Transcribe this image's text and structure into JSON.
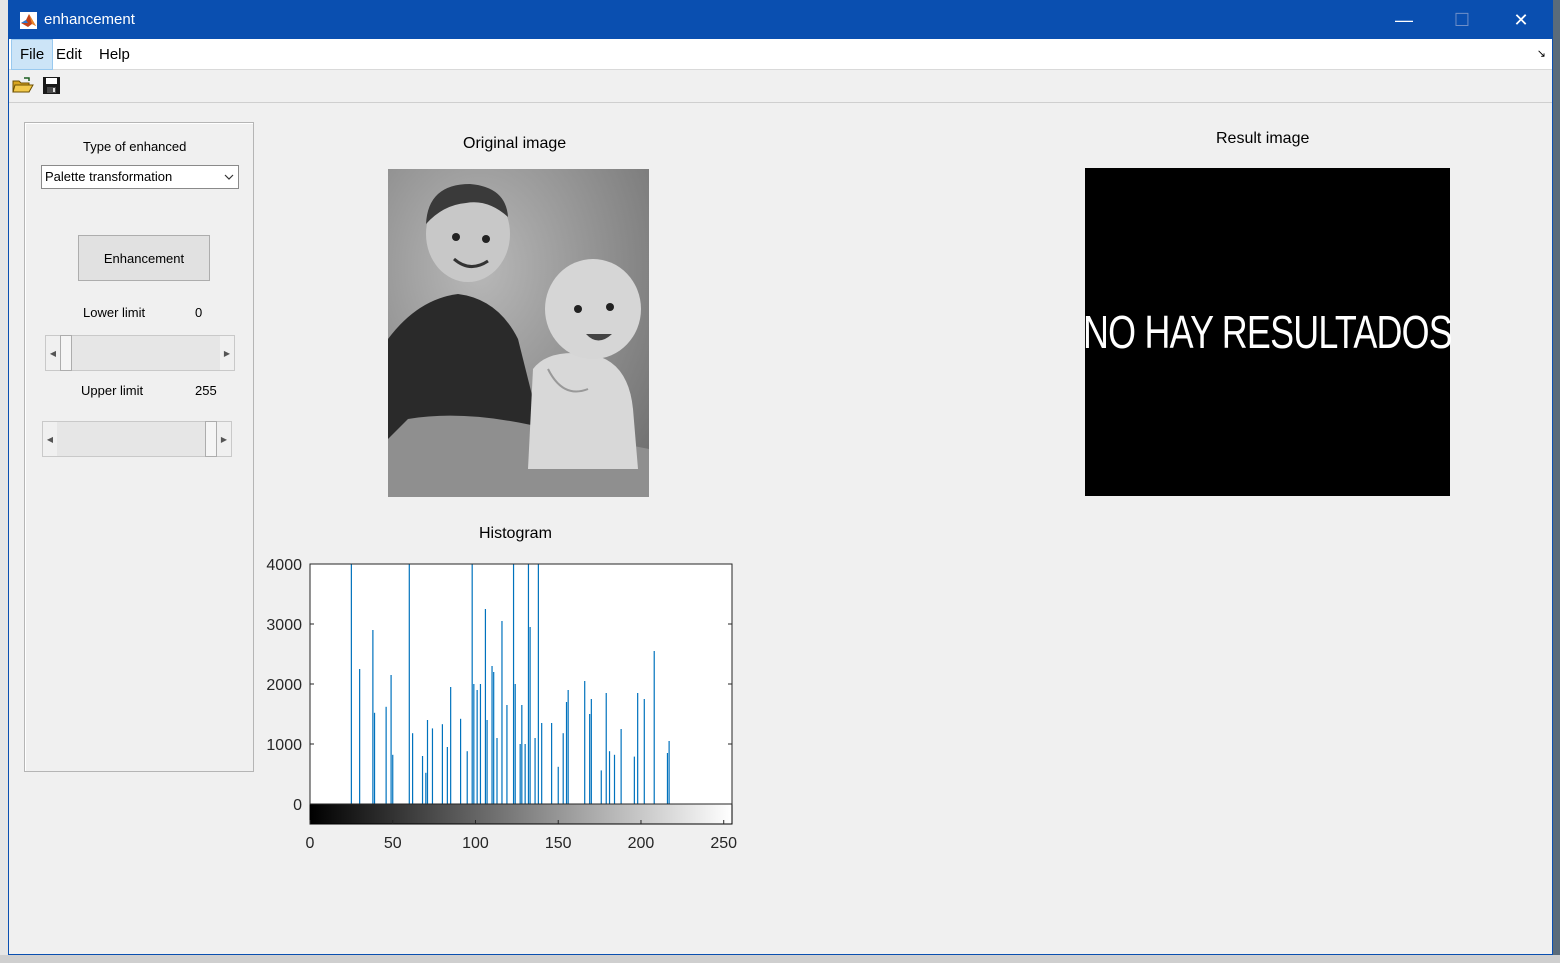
{
  "window": {
    "title": "enhancement",
    "minimize_glyph": "—",
    "maximize_glyph": "☐",
    "close_glyph": "✕"
  },
  "menu": {
    "items": [
      "File",
      "Edit",
      "Help"
    ]
  },
  "toolbar": {
    "icons": [
      "open-folder-icon",
      "save-icon"
    ]
  },
  "controls": {
    "type_label": "Type of enhanced",
    "type_value": "Palette transformation",
    "enhance_button": "Enhancement",
    "lower_label": "Lower limit",
    "lower_value": "0",
    "upper_label": "Upper limit",
    "upper_value": "255",
    "lower_slider_fraction": 0,
    "upper_slider_fraction": 1
  },
  "original": {
    "title": "Original image"
  },
  "result": {
    "title": "Result image",
    "text": "NO HAY RESULTADOS"
  },
  "histogram": {
    "title": "Histogram"
  },
  "colors": {
    "titlebar": "#0a4fb0",
    "bar": "#0072bd"
  },
  "chart_data": {
    "type": "bar",
    "title": "Histogram",
    "xlim": [
      0,
      255
    ],
    "ylim": [
      0,
      4000
    ],
    "xticks": [
      "0",
      "50",
      "100",
      "150",
      "200",
      "250"
    ],
    "yticks": [
      "0",
      "1000",
      "2000",
      "3000",
      "4000"
    ],
    "bars": [
      [
        25,
        4000
      ],
      [
        30,
        2250
      ],
      [
        38,
        2900
      ],
      [
        39,
        1520
      ],
      [
        46,
        1620
      ],
      [
        49,
        2150
      ],
      [
        50,
        820
      ],
      [
        60,
        4000
      ],
      [
        62,
        1180
      ],
      [
        68,
        800
      ],
      [
        70,
        520
      ],
      [
        71,
        1400
      ],
      [
        74,
        1260
      ],
      [
        80,
        1330
      ],
      [
        83,
        950
      ],
      [
        85,
        1950
      ],
      [
        91,
        1420
      ],
      [
        95,
        880
      ],
      [
        98,
        4000
      ],
      [
        99,
        2000
      ],
      [
        101,
        1900
      ],
      [
        103,
        2000
      ],
      [
        106,
        3250
      ],
      [
        107,
        1400
      ],
      [
        110,
        2300
      ],
      [
        111,
        2200
      ],
      [
        113,
        1100
      ],
      [
        116,
        3050
      ],
      [
        119,
        1650
      ],
      [
        123,
        4000
      ],
      [
        124,
        2000
      ],
      [
        127,
        1000
      ],
      [
        128,
        1650
      ],
      [
        130,
        1000
      ],
      [
        132,
        4000
      ],
      [
        133,
        2950
      ],
      [
        136,
        1100
      ],
      [
        138,
        4000
      ],
      [
        140,
        1350
      ],
      [
        146,
        1350
      ],
      [
        150,
        620
      ],
      [
        153,
        1180
      ],
      [
        155,
        1700
      ],
      [
        156,
        1900
      ],
      [
        166,
        2050
      ],
      [
        169,
        1500
      ],
      [
        170,
        1750
      ],
      [
        176,
        560
      ],
      [
        179,
        1850
      ],
      [
        181,
        880
      ],
      [
        184,
        820
      ],
      [
        188,
        1250
      ],
      [
        196,
        790
      ],
      [
        198,
        1850
      ],
      [
        202,
        1750
      ],
      [
        208,
        2550
      ],
      [
        216,
        850
      ],
      [
        217,
        1050
      ]
    ]
  }
}
